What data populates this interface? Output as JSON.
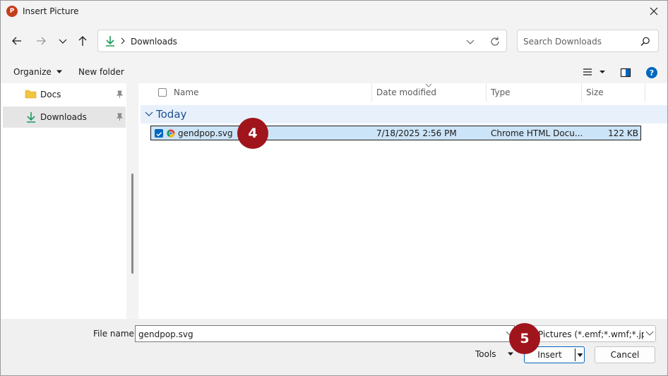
{
  "window": {
    "title": "Insert Picture"
  },
  "address": {
    "path": "Downloads"
  },
  "search": {
    "placeholder": "Search Downloads"
  },
  "toolbar": {
    "organize_label": "Organize",
    "new_folder_label": "New folder"
  },
  "sidebar": {
    "items": [
      {
        "label": "Docs"
      },
      {
        "label": "Downloads"
      }
    ]
  },
  "columns": {
    "name": "Name",
    "date_modified": "Date modified",
    "type": "Type",
    "size": "Size"
  },
  "group": {
    "label": "Today"
  },
  "files": [
    {
      "name": "gendpop.svg",
      "date_modified": "7/18/2025 2:56 PM",
      "type": "Chrome HTML Docu...",
      "size": "122 KB"
    }
  ],
  "footer": {
    "file_name_label": "File name:",
    "file_name_value": "gendpop.svg",
    "filter_value": "Pictures (*.emf;*.wmf;*.jpg;*",
    "tools_label": "Tools",
    "insert_label": "Insert",
    "cancel_label": "Cancel"
  },
  "annotations": {
    "step_row": "4",
    "step_insert": "5"
  },
  "colors": {
    "accent": "#0067c0",
    "badge": "#a0151c",
    "selection": "#cce4f7",
    "download_green": "#1a9b5a"
  }
}
